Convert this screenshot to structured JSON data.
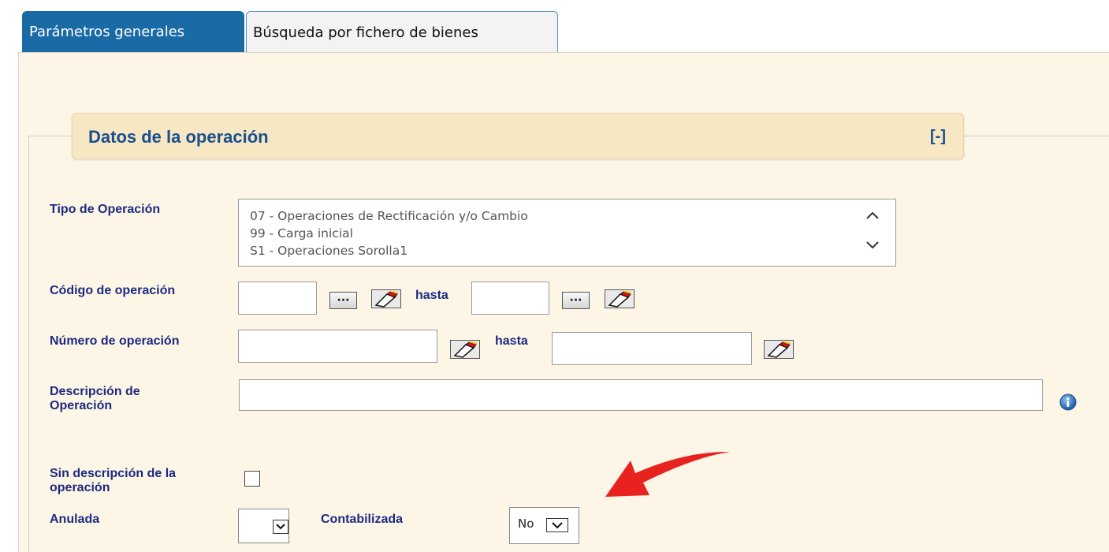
{
  "tabs": [
    {
      "label": "Parámetros generales",
      "active": true
    },
    {
      "label": "Búsqueda por fichero de bienes",
      "active": false
    }
  ],
  "section": {
    "title": "Datos de la operación",
    "collapse_label": "[-]"
  },
  "form": {
    "tipo_operacion": {
      "label": "Tipo de Operación",
      "options": [
        "07 - Operaciones de Rectificación y/o Cambio",
        "99 - Carga inicial",
        "S1 - Operaciones Sorolla1"
      ]
    },
    "codigo_operacion": {
      "label": "Código de operación",
      "from_value": "",
      "hasta_label": "hasta",
      "to_value": "",
      "lookup_label": "···"
    },
    "numero_operacion": {
      "label": "Número de operación",
      "from_value": "",
      "hasta_label": "hasta",
      "to_value": ""
    },
    "descripcion_operacion": {
      "label_line1": "Descripción de",
      "label_line2": "Operación",
      "value": ""
    },
    "sin_descripcion": {
      "label_line1": "Sin descripción de la",
      "label_line2": "operación",
      "checked": false
    },
    "anulada": {
      "label": "Anulada",
      "value": ""
    },
    "contabilizada": {
      "label": "Contabilizada",
      "value": "No"
    }
  },
  "colors": {
    "tab_active": "#1a6aa6",
    "label_text": "#1c2a80",
    "section_title": "#1a4f8c",
    "panel_bg": "#fdf6e7",
    "section_header_bg": "#f7e7c3",
    "annotation_arrow": "#e8231f"
  },
  "icons": {
    "eraser": "eraser-icon",
    "info": "info-icon",
    "scroll_up": "chevron-up-icon",
    "scroll_down": "chevron-down-icon",
    "dropdown": "chevron-down-icon",
    "annotation": "red-arrow-icon"
  }
}
